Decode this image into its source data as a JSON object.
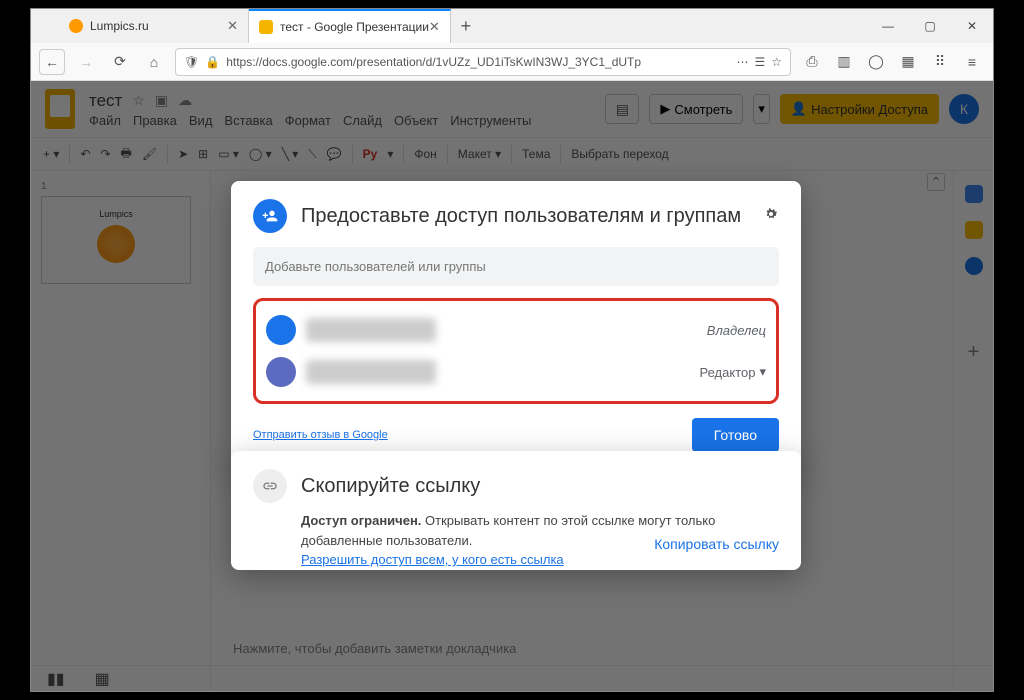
{
  "browser": {
    "tabs": [
      {
        "title": "Lumpics.ru"
      },
      {
        "title": "тест - Google Презентации"
      }
    ],
    "url": "https://docs.google.com/presentation/d/1vUZz_UD1iTsKwIN3WJ_3YC1_dUTр",
    "win": {
      "min": "—",
      "max": "▢",
      "close": "✕"
    }
  },
  "app": {
    "doc_title": "тест",
    "menus": [
      "Файл",
      "Правка",
      "Вид",
      "Вставка",
      "Формат",
      "Слайд",
      "Объект",
      "Инструменты"
    ],
    "present": "Смотреть",
    "share": "Настройки Доступа",
    "avatar": "К",
    "toolbar": {
      "py": "Py",
      "bg": "Фон",
      "layout": "Макет",
      "theme": "Тема",
      "trans": "Выбрать переход"
    },
    "slide_label": "Lumpics",
    "notes": "Нажмите, чтобы добавить заметки докладчика"
  },
  "share": {
    "title": "Предоставьте доступ пользователям и группам",
    "placeholder": "Добавьте пользователей или группы",
    "owner": "Владелец",
    "editor": "Редактор",
    "feedback": "Отправить отзыв в Google",
    "done": "Готово"
  },
  "link": {
    "title": "Скопируйте ссылку",
    "restricted": "Доступ ограничен.",
    "desc": "Открывать контент по этой ссылке могут только добавленные пользователи.",
    "change": "Разрешить доступ всем, у кого есть ссылка",
    "copy": "Копировать ссылку"
  }
}
